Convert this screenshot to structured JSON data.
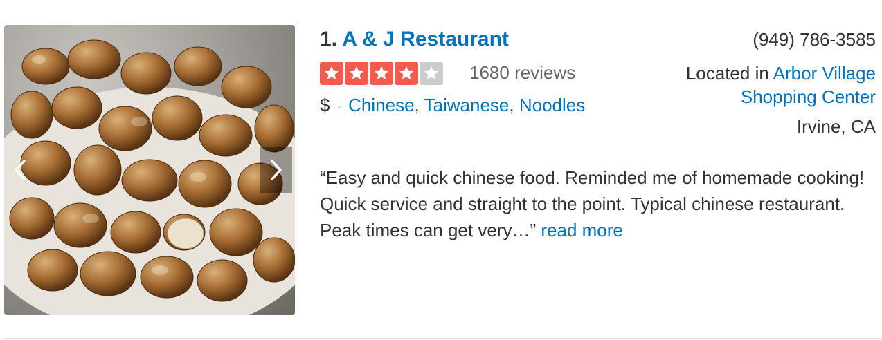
{
  "listing": {
    "index": "1.",
    "name": "A & J Restaurant",
    "rating": 4,
    "rating_max": 5,
    "reviews": "1680 reviews",
    "price": "$",
    "separator": "·",
    "categories": [
      "Chinese",
      "Taiwanese",
      "Noodles"
    ],
    "phone": "(949) 786-3585",
    "located_prefix": "Located in",
    "located_place": "Arbor Village Shopping Center",
    "city": "Irvine, CA",
    "snippet": "“Easy and quick chinese food. Reminded me of homemade cooking! Quick service and straight to the point. Typical chinese restaurant.  Peak times can get very…”",
    "read_more": "read more"
  },
  "colors": {
    "link": "#0073bb",
    "star_filled": "#f15c4f",
    "star_empty": "#cccccc"
  },
  "icons": {
    "prev": "chevron-left-icon",
    "next": "chevron-right-icon",
    "star": "star-icon"
  }
}
